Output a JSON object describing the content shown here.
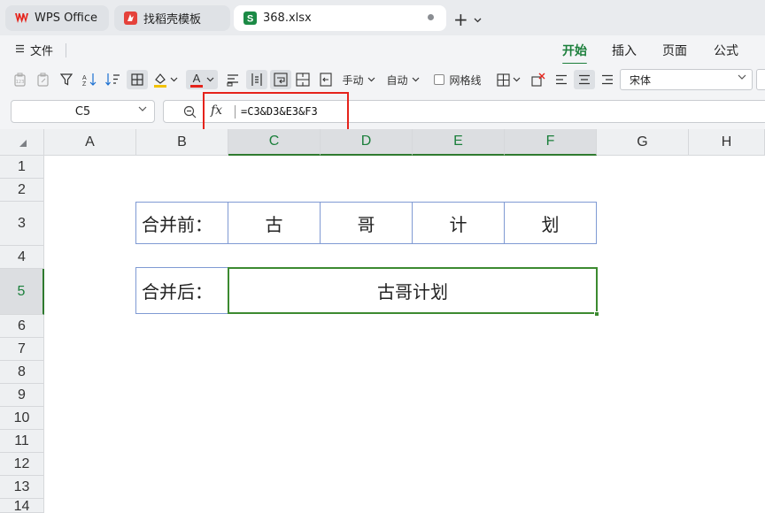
{
  "tabs": [
    {
      "label": "WPS Office",
      "icon": "wps-logo-icon",
      "color": "#e5231b"
    },
    {
      "label": "找稻壳模板",
      "icon": "docer-logo-icon",
      "color": "#e5423b"
    },
    {
      "label": "368.xlsx",
      "icon": "sheet-file-icon",
      "color": "#1b8a45"
    }
  ],
  "tab_actions": {
    "new": "+",
    "more": "⌄"
  },
  "menu": {
    "file_label": "文件"
  },
  "ribbon_tabs": [
    "开始",
    "插入",
    "页面",
    "公式"
  ],
  "toolbar": {
    "manual_label": "手动",
    "auto_label": "自动",
    "gridlines_label": "网格线",
    "font_name": "宋体",
    "accent_color": "#1b7f3b",
    "font_color_bar": "#e5231b",
    "fill_color_bar": "#f2c200"
  },
  "formula_bar": {
    "cell_ref": "C5",
    "fx_label": "fx",
    "formula": "=C3&D3&E3&F3",
    "highlight_color": "#e5231b"
  },
  "columns": [
    "A",
    "B",
    "C",
    "D",
    "E",
    "F",
    "G",
    "H"
  ],
  "rows": [
    "1",
    "2",
    "3",
    "4",
    "5",
    "6",
    "7",
    "8",
    "9",
    "10",
    "11",
    "12",
    "13",
    "14"
  ],
  "cells": {
    "B3": "合并前：",
    "C3": "古",
    "D3": "哥",
    "E3": "计",
    "F3": "划",
    "B5": "合并后：",
    "C5": "古哥计划"
  },
  "selection": {
    "active_cell": "C5",
    "selection_color": "#3c8a30"
  }
}
